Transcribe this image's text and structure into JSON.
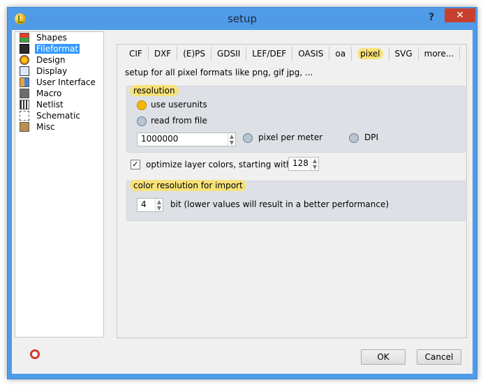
{
  "window": {
    "title": "setup",
    "help": "?",
    "close": "✕"
  },
  "sidebar": {
    "items": [
      {
        "label": "Shapes",
        "icon": "shapes-icon"
      },
      {
        "label": "Fileformat",
        "icon": "fileformat-icon",
        "selected": true
      },
      {
        "label": "Design",
        "icon": "design-icon"
      },
      {
        "label": "Display",
        "icon": "display-icon"
      },
      {
        "label": "User Interface",
        "icon": "user-interface-icon"
      },
      {
        "label": "Macro",
        "icon": "macro-icon"
      },
      {
        "label": "Netlist",
        "icon": "netlist-icon"
      },
      {
        "label": "Schematic",
        "icon": "schematic-icon"
      },
      {
        "label": "Misc",
        "icon": "misc-icon"
      }
    ]
  },
  "tabs": [
    {
      "label": "CIF"
    },
    {
      "label": "DXF"
    },
    {
      "label": "(E)PS"
    },
    {
      "label": "GDSII"
    },
    {
      "label": "LEF/DEF"
    },
    {
      "label": "OASIS"
    },
    {
      "label": "oa"
    },
    {
      "label": "pixel",
      "active": true
    },
    {
      "label": "SVG"
    },
    {
      "label": "more..."
    }
  ],
  "pixel": {
    "intro": "setup for all pixel formats like png, gif jpg, ...",
    "resolution": {
      "title": "resolution",
      "use_userunits": "use userunits",
      "read_from_file": "read from file",
      "value": "1000000",
      "pixel_per_meter": "pixel per meter",
      "dpi": "DPI",
      "selected": "use userunits"
    },
    "optimize": {
      "label": "optimize layer colors, starting with layer",
      "checked": true,
      "value": "128"
    },
    "color": {
      "title": "color resolution for import",
      "value": "4",
      "label": "bit (lower values will result in a better performance)"
    }
  },
  "buttons": {
    "ok": "OK",
    "cancel": "Cancel"
  },
  "colors": {
    "accent": "#3399ff",
    "highlight": "#f7e27a",
    "titlebar": "#4f9be8",
    "close": "#c7402f"
  }
}
